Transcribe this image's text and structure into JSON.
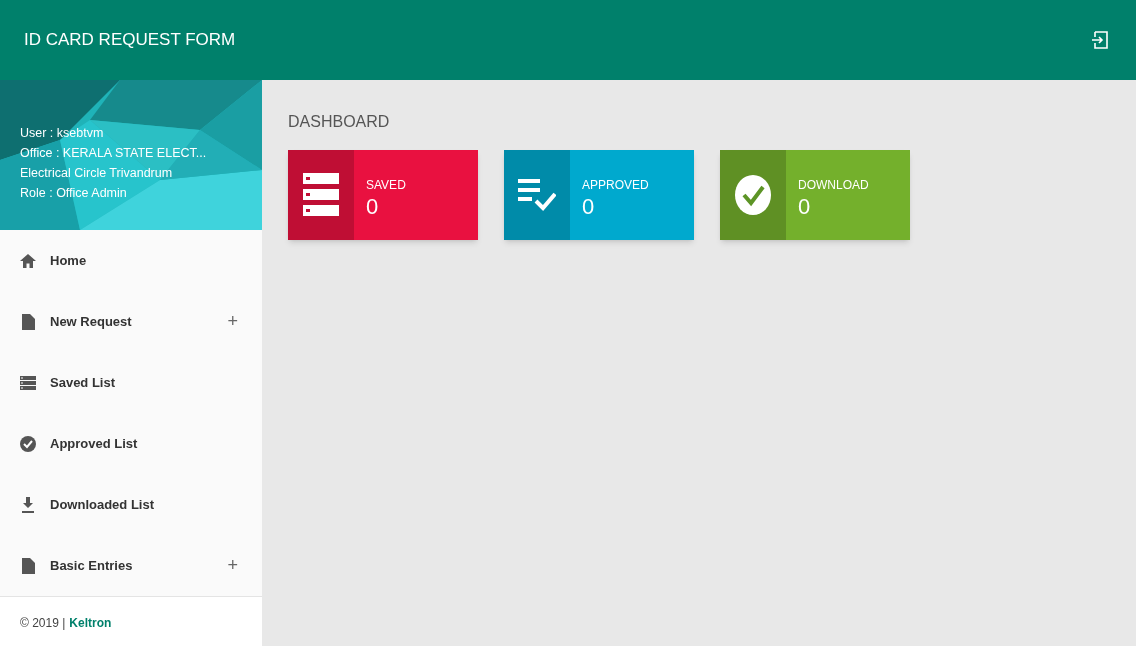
{
  "header": {
    "title": "ID CARD REQUEST FORM"
  },
  "profile": {
    "lines": [
      "User : ksebtvm",
      "Office : KERALA STATE ELECT...",
      "Electrical Circle Trivandrum",
      "Role : Office Admin"
    ]
  },
  "menu": [
    {
      "kind": "home",
      "label": "Home"
    },
    {
      "kind": "file",
      "label": "New Request",
      "toggle": "+"
    },
    {
      "kind": "list",
      "label": "Saved List"
    },
    {
      "kind": "check",
      "label": "Approved List"
    },
    {
      "kind": "download",
      "label": "Downloaded List"
    },
    {
      "kind": "file",
      "label": "Basic Entries",
      "toggle": "+"
    }
  ],
  "footer": {
    "text": "© 2019 |",
    "link": "Keltron"
  },
  "dashboard": {
    "heading": "DASHBOARD",
    "cards": [
      {
        "kind": "list",
        "label": "SAVED",
        "count": "0",
        "color": "#e91140"
      },
      {
        "kind": "checklist",
        "label": "APPROVED",
        "count": "0",
        "color": "#00a9ce"
      },
      {
        "kind": "check",
        "label": "DOWNLOAD",
        "count": "0",
        "color": "#74b02c"
      }
    ]
  }
}
